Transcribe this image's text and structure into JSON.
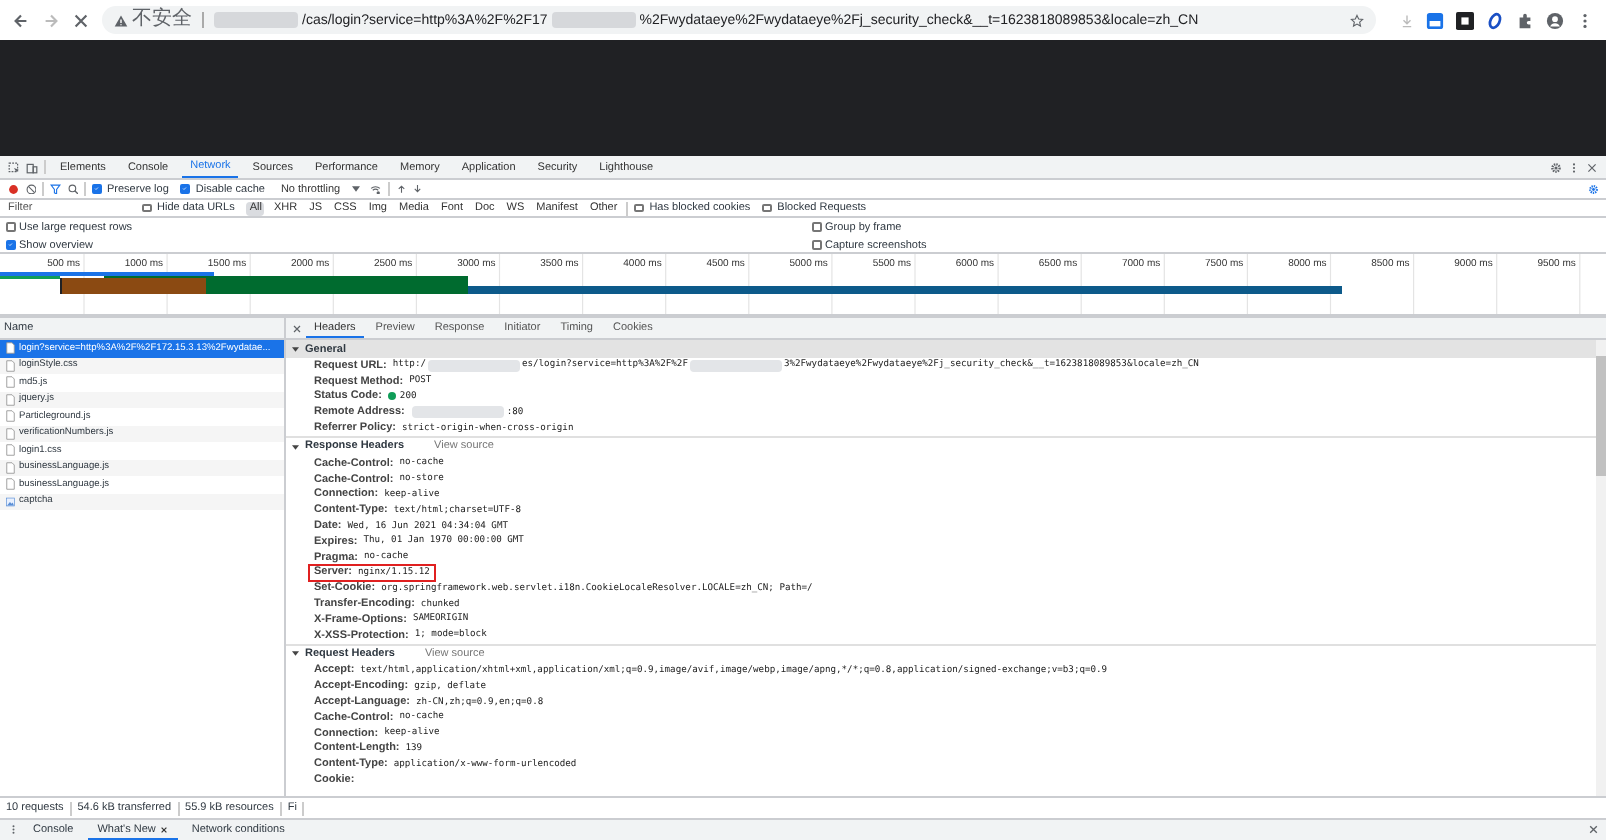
{
  "address_bar": {
    "security_label": "不安全",
    "url_parts": [
      {
        "kind": "redacted"
      },
      {
        "kind": "text",
        "text": "/cas/login?service=http%3A%2F%2F17"
      },
      {
        "kind": "redacted"
      },
      {
        "kind": "text",
        "text": "%2Fwydataeye%2Fwydataeye%2Fj_security_check&__t=1623818089853&locale=zh_CN"
      }
    ]
  },
  "devtools_tabs": [
    {
      "label": "Elements",
      "selected": false
    },
    {
      "label": "Console",
      "selected": false
    },
    {
      "label": "Network",
      "selected": true
    },
    {
      "label": "Sources",
      "selected": false
    },
    {
      "label": "Performance",
      "selected": false
    },
    {
      "label": "Memory",
      "selected": false
    },
    {
      "label": "Application",
      "selected": false
    },
    {
      "label": "Security",
      "selected": false
    },
    {
      "label": "Lighthouse",
      "selected": false
    }
  ],
  "toolbar": {
    "checks": [
      {
        "label": "Preserve log",
        "checked": true
      },
      {
        "label": "Disable cache",
        "checked": true
      }
    ],
    "throttling": "No throttling"
  },
  "filter_bar": {
    "placeholder": "Filter",
    "hide_data_urls": {
      "label": "Hide data URLs",
      "checked": false
    },
    "types": [
      {
        "label": "All",
        "selected": true
      },
      {
        "label": "XHR",
        "selected": false
      },
      {
        "label": "JS",
        "selected": false
      },
      {
        "label": "CSS",
        "selected": false
      },
      {
        "label": "Img",
        "selected": false
      },
      {
        "label": "Media",
        "selected": false
      },
      {
        "label": "Font",
        "selected": false
      },
      {
        "label": "Doc",
        "selected": false
      },
      {
        "label": "WS",
        "selected": false
      },
      {
        "label": "Manifest",
        "selected": false
      },
      {
        "label": "Other",
        "selected": false
      }
    ],
    "blocked": [
      {
        "label": "Has blocked cookies",
        "checked": false
      },
      {
        "label": "Blocked Requests",
        "checked": false
      }
    ]
  },
  "options": [
    {
      "label": "Use large request rows",
      "checked": false
    },
    {
      "label": "Group by frame",
      "checked": false
    },
    {
      "label": "Show overview",
      "checked": true
    },
    {
      "label": "Capture screenshots",
      "checked": false
    }
  ],
  "overview": {
    "ticks": [
      "500 ms",
      "1000 ms",
      "1500 ms",
      "2000 ms",
      "2500 ms",
      "3000 ms",
      "3500 ms",
      "4000 ms",
      "4500 ms",
      "5000 ms",
      "5500 ms",
      "6000 ms",
      "6500 ms",
      "7000 ms",
      "7500 ms",
      "8000 ms",
      "8500 ms",
      "9000 ms",
      "9500 ms"
    ]
  },
  "requests": {
    "column": "Name",
    "items": [
      {
        "name": "login?service=http%3A%2F%2F172.15.3.13%2Fwydatae...",
        "kind": "document",
        "selected": true
      },
      {
        "name": "loginStyle.css",
        "kind": "document",
        "selected": false
      },
      {
        "name": "md5.js",
        "kind": "document",
        "selected": false
      },
      {
        "name": "jquery.js",
        "kind": "document",
        "selected": false
      },
      {
        "name": "Particleground.js",
        "kind": "document",
        "selected": false
      },
      {
        "name": "verificationNumbers.js",
        "kind": "document",
        "selected": false
      },
      {
        "name": "login1.css",
        "kind": "document",
        "selected": false
      },
      {
        "name": "businessLanguage.js",
        "kind": "document",
        "selected": false
      },
      {
        "name": "businessLanguage.js",
        "kind": "document",
        "selected": false
      },
      {
        "name": "captcha",
        "kind": "image",
        "selected": false
      }
    ]
  },
  "detail_tabs": [
    {
      "label": "Headers",
      "selected": true
    },
    {
      "label": "Preview",
      "selected": false
    },
    {
      "label": "Response",
      "selected": false
    },
    {
      "label": "Initiator",
      "selected": false
    },
    {
      "label": "Timing",
      "selected": false
    },
    {
      "label": "Cookies",
      "selected": false
    }
  ],
  "sections": [
    {
      "title": "General",
      "expanded": true,
      "focused": true,
      "rows": [
        {
          "name": "Request URL:",
          "kind": "parts",
          "parts": [
            {
              "kind": "text",
              "text": "http:/"
            },
            {
              "kind": "redacted"
            },
            {
              "kind": "text",
              "text": "es/login?service=http%3A%2F%2F"
            },
            {
              "kind": "redacted"
            },
            {
              "kind": "text",
              "text": "3%2Fwydataeye%2Fwydataeye%2Fj_security_check&__t=1623818089853&locale=zh_CN"
            }
          ]
        },
        {
          "name": "Request Method:",
          "kind": "plain",
          "value": "POST"
        },
        {
          "name": "Status Code:",
          "kind": "status",
          "value": "200"
        },
        {
          "name": "Remote Address:",
          "kind": "parts",
          "parts": [
            {
              "kind": "redacted"
            },
            {
              "kind": "text",
              "text": ":80"
            }
          ]
        },
        {
          "name": "Referrer Policy:",
          "kind": "plain",
          "value": "strict-origin-when-cross-origin"
        }
      ]
    },
    {
      "title": "Response Headers",
      "view_source": "View source",
      "expanded": true,
      "focused": false,
      "rows": [
        {
          "name": "Cache-Control:",
          "kind": "plain",
          "value": "no-cache"
        },
        {
          "name": "Cache-Control:",
          "kind": "plain",
          "value": "no-store"
        },
        {
          "name": "Connection:",
          "kind": "plain",
          "value": "keep-alive"
        },
        {
          "name": "Content-Type:",
          "kind": "plain",
          "value": "text/html;charset=UTF-8"
        },
        {
          "name": "Date:",
          "kind": "plain",
          "value": "Wed, 16 Jun 2021 04:34:04 GMT"
        },
        {
          "name": "Expires:",
          "kind": "plain",
          "value": "Thu, 01 Jan 1970 00:00:00 GMT"
        },
        {
          "name": "Pragma:",
          "kind": "plain",
          "value": "no-cache"
        },
        {
          "name": "Server:",
          "kind": "highlighted",
          "value": "nginx/1.15.12"
        },
        {
          "name": "Set-Cookie:",
          "kind": "plain",
          "value": "org.springframework.web.servlet.i18n.CookieLocaleResolver.LOCALE=zh_CN; Path=/"
        },
        {
          "name": "Transfer-Encoding:",
          "kind": "plain",
          "value": "chunked"
        },
        {
          "name": "X-Frame-Options:",
          "kind": "plain",
          "value": "SAMEORIGIN"
        },
        {
          "name": "X-XSS-Protection:",
          "kind": "plain",
          "value": "1; mode=block"
        }
      ]
    },
    {
      "title": "Request Headers",
      "view_source": "View source",
      "expanded": true,
      "focused": false,
      "rows": [
        {
          "name": "Accept:",
          "kind": "plain",
          "value": "text/html,application/xhtml+xml,application/xml;q=0.9,image/avif,image/webp,image/apng,*/*;q=0.8,application/signed-exchange;v=b3;q=0.9"
        },
        {
          "name": "Accept-Encoding:",
          "kind": "plain",
          "value": "gzip, deflate"
        },
        {
          "name": "Accept-Language:",
          "kind": "plain",
          "value": "zh-CN,zh;q=0.9,en;q=0.8"
        },
        {
          "name": "Cache-Control:",
          "kind": "plain",
          "value": "no-cache"
        },
        {
          "name": "Connection:",
          "kind": "plain",
          "value": "keep-alive"
        },
        {
          "name": "Content-Length:",
          "kind": "plain",
          "value": "139"
        },
        {
          "name": "Content-Type:",
          "kind": "plain",
          "value": "application/x-www-form-urlencoded"
        },
        {
          "name": "Cookie:",
          "kind": "plain"
        }
      ]
    }
  ],
  "status_bar": [
    "10 requests",
    "54.6 kB transferred",
    "55.9 kB resources",
    "Fi"
  ],
  "drawer_tabs": [
    {
      "label": "Console",
      "selected": false,
      "closable": false
    },
    {
      "label": "What's New",
      "selected": true,
      "closable": true
    },
    {
      "label": "Network conditions",
      "selected": false,
      "closable": false
    }
  ]
}
